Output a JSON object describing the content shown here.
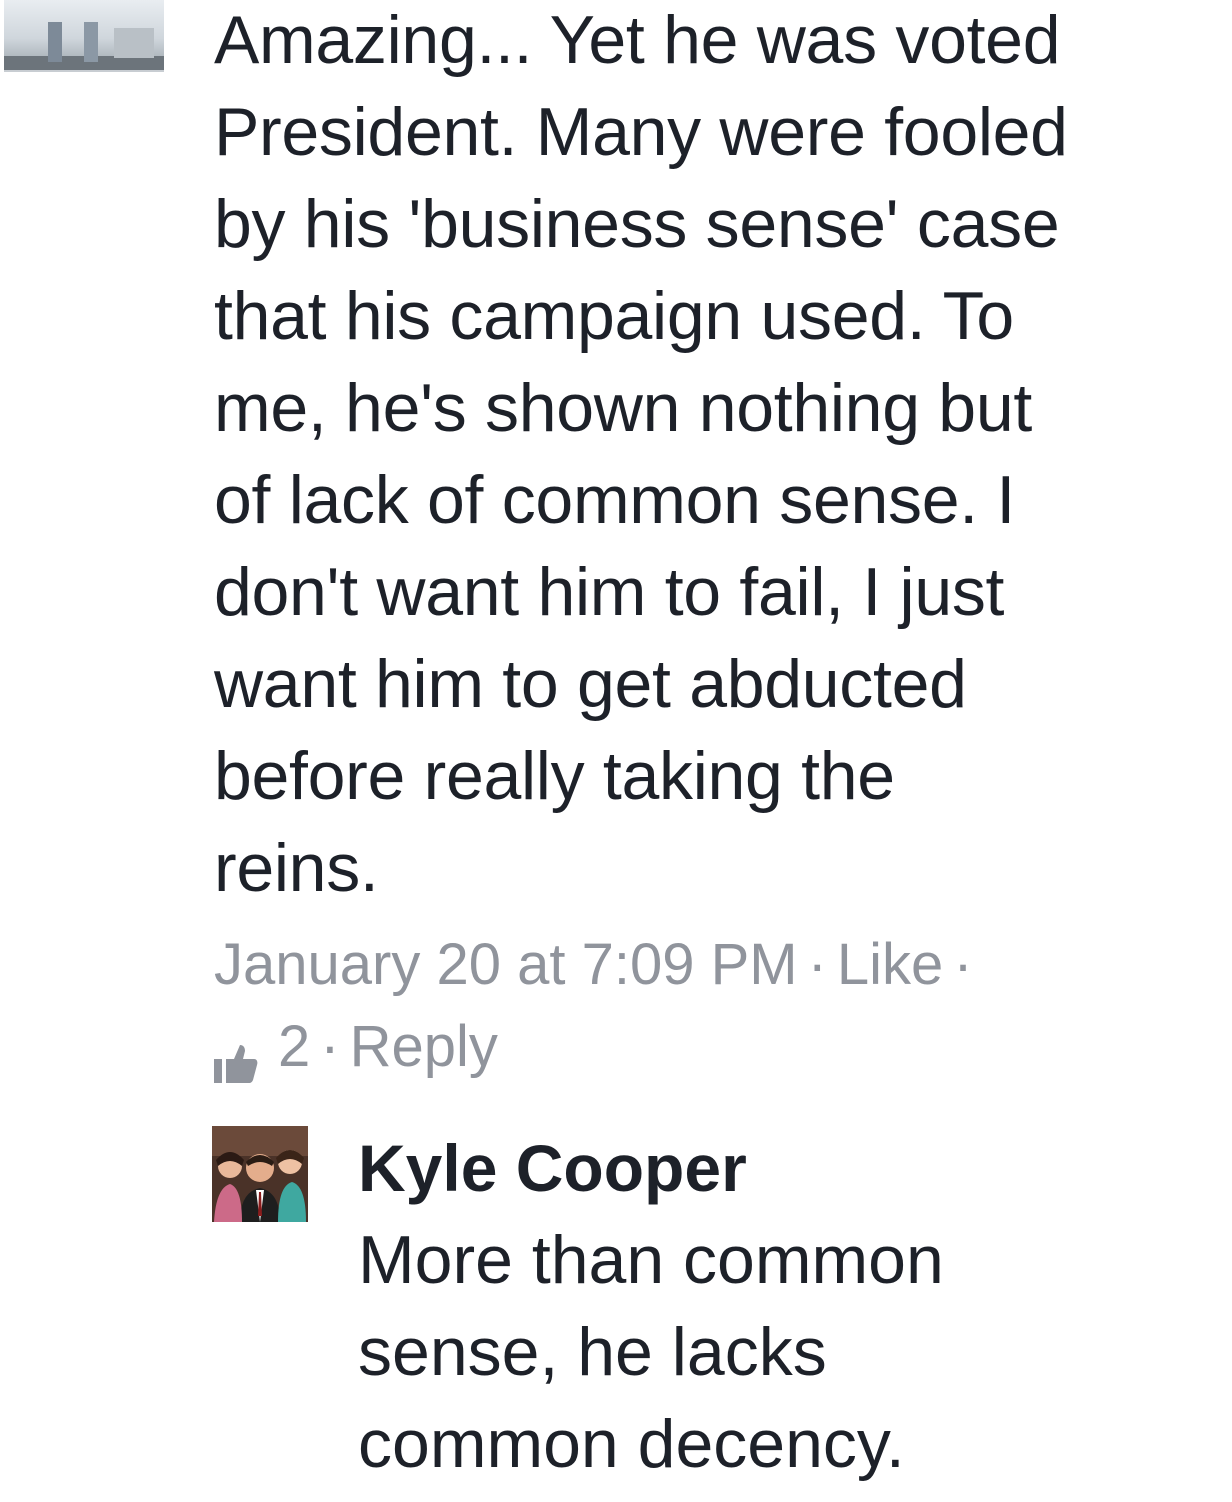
{
  "thread": {
    "parent_comment": {
      "avatar_icon": "user-photo-avatar",
      "text": "Amazing... Yet he was voted\nPresident. Many were fooled\nby his 'business sense' case\nthat his campaign used. To\nme, he's shown nothing but\nof lack of common sense. I\ndon't want him to fail, I just\nwant him to get abducted\nbefore really taking the\nreins.",
      "timestamp": "January 20 at 7:09 PM",
      "like_label": "Like",
      "separator": "·",
      "like_count": "2",
      "like_icon": "thumbs-up-icon",
      "reply_label": "Reply"
    },
    "reply": {
      "avatar_icon": "user-photo-avatar",
      "author": "Kyle Cooper",
      "text": "More than common\nsense, he lacks\ncommon decency."
    }
  },
  "colors": {
    "text": "#1d2129",
    "meta": "#90949c"
  }
}
